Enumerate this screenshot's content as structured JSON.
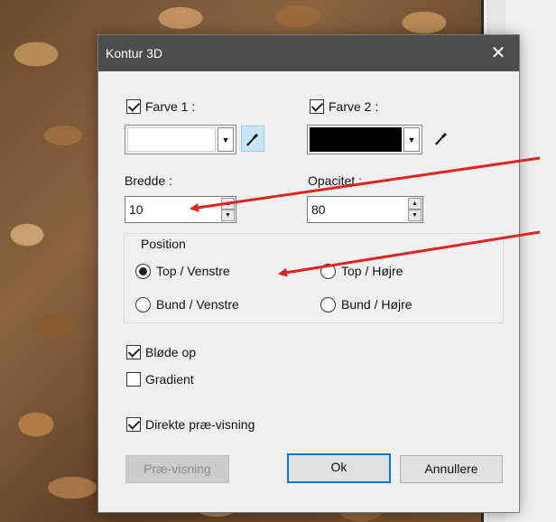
{
  "dialog": {
    "title": "Kontur 3D",
    "close_glyph": "✕"
  },
  "color1": {
    "label": "Farve 1 :",
    "checked": true,
    "swatch_color": "#ffffff",
    "dropdown_glyph": "▼"
  },
  "color2": {
    "label": "Farve 2 :",
    "checked": true,
    "swatch_color": "#000000",
    "dropdown_glyph": "▼"
  },
  "width": {
    "label": "Bredde :",
    "value": "10"
  },
  "opacity": {
    "label": "Opacitet :",
    "value": "80"
  },
  "spin_glyphs": {
    "up": "▲",
    "down": "▼"
  },
  "position": {
    "title": "Position",
    "options": [
      {
        "label": "Top / Venstre",
        "selected": true
      },
      {
        "label": "Top / Højre",
        "selected": false
      },
      {
        "label": "Bund / Venstre",
        "selected": false
      },
      {
        "label": "Bund / Højre",
        "selected": false
      }
    ]
  },
  "options": {
    "blur_label": "Bløde op",
    "blur_checked": true,
    "gradient_label": "Gradient",
    "gradient_checked": false,
    "live_preview_label": "Direkte præ-visning",
    "live_preview_checked": true
  },
  "buttons": {
    "preview": "Præ-visning",
    "ok": "Ok",
    "cancel": "Annullere"
  },
  "colors": {
    "title_bar": "#4d4d4d",
    "dialog_bg": "#f0f0f0",
    "accent": "#0078d7",
    "annotation_arrow": "#e52222"
  },
  "icons": {
    "eyedropper": "eyedropper-icon",
    "close": "close-icon",
    "dropdown": "chevron-down-icon"
  }
}
